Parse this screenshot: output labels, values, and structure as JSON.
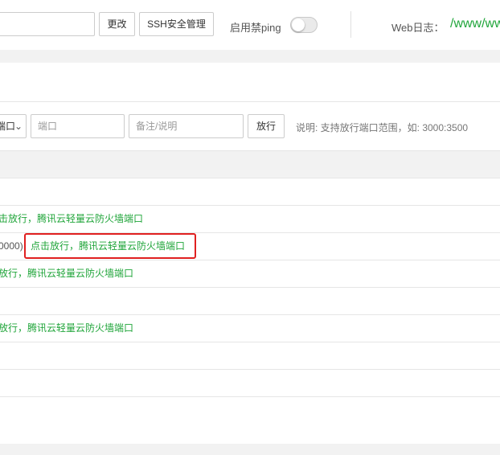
{
  "toolbar": {
    "ssh_port_value": "",
    "change_button": "更改",
    "ssh_manage_button": "SSH安全管理",
    "ping_label": "启用禁ping",
    "ping_toggle_on": false,
    "weblog_label": "Web日志：",
    "weblog_path": "/www/ww"
  },
  "rule_form": {
    "protocol_select": "端口",
    "port_placeholder": "端口",
    "remark_placeholder": "备注/说明",
    "allow_button": "放行",
    "hint": "说明: 支持放行端口范围，如: 3000:3500"
  },
  "rows": [
    {
      "text": "击放行，腾讯云轻量云防火墙端口"
    },
    {
      "prefix": "0000)",
      "link": "点击放行，腾讯云轻量云防火墙端口"
    },
    {
      "text": "放行，腾讯云轻量云防火墙端口"
    },
    {
      "text": "放行，腾讯云轻量云防火墙端口"
    }
  ],
  "colors": {
    "accent_green": "#20a53a",
    "highlight_red": "#e02020"
  }
}
